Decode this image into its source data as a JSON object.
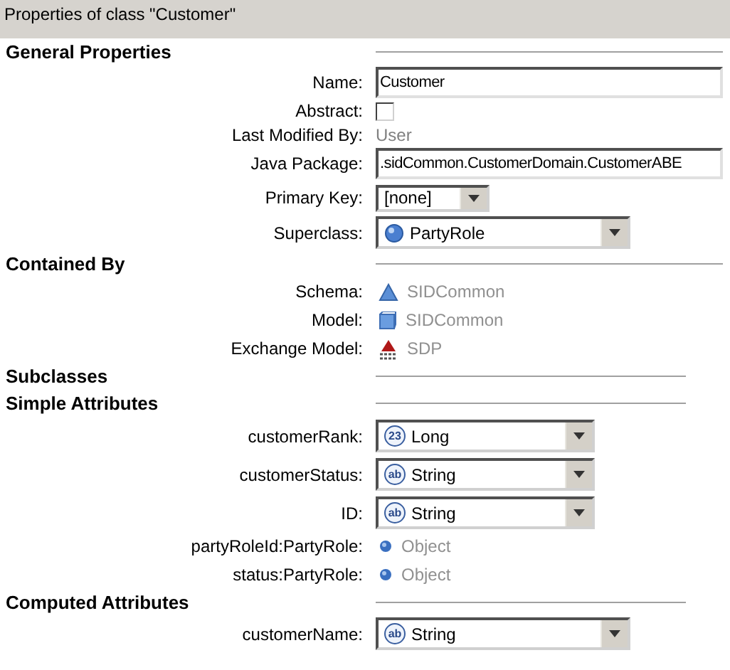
{
  "window": {
    "title": "Properties of class \"Customer\""
  },
  "sections": [
    {
      "title": "General Properties",
      "rows": [
        {
          "kind": "text",
          "label": "Name:",
          "value": "Customer"
        },
        {
          "kind": "checkbox",
          "label": "Abstract:",
          "checked": false
        },
        {
          "kind": "readonly",
          "label": "Last Modified By:",
          "value": "User"
        },
        {
          "kind": "text",
          "label": "Java Package:",
          "value": ".sidCommon.CustomerDomain.CustomerABE"
        },
        {
          "kind": "combo_small",
          "label": "Primary Key:",
          "value": "[none]"
        },
        {
          "kind": "combo_class",
          "label": "Superclass:",
          "value": "PartyRole"
        }
      ]
    },
    {
      "title": "Contained By",
      "rows": [
        {
          "kind": "ref_schema",
          "label": "Schema:",
          "value": "SIDCommon"
        },
        {
          "kind": "ref_model",
          "label": "Model:",
          "value": "SIDCommon"
        },
        {
          "kind": "ref_exchange",
          "label": "Exchange Model:",
          "value": "SDP"
        }
      ]
    },
    {
      "title": "Subclasses"
    },
    {
      "title": "Simple Attributes",
      "rows": [
        {
          "kind": "combo",
          "label": "customerRank:",
          "value": "Long",
          "badge": "23"
        },
        {
          "kind": "combo",
          "label": "customerStatus:",
          "value": "String",
          "badge": "ab"
        },
        {
          "kind": "combo",
          "label": "ID:",
          "value": "String",
          "badge": "ab"
        },
        {
          "kind": "ref_object",
          "label": "partyRoleId:PartyRole:",
          "value": "Object"
        },
        {
          "kind": "ref_object",
          "label": "status:PartyRole:",
          "value": "Object"
        }
      ]
    },
    {
      "title": "Computed Attributes",
      "rows": [
        {
          "kind": "combo_wide",
          "label": "customerName:",
          "value": "String",
          "badge": "ab"
        }
      ]
    }
  ]
}
